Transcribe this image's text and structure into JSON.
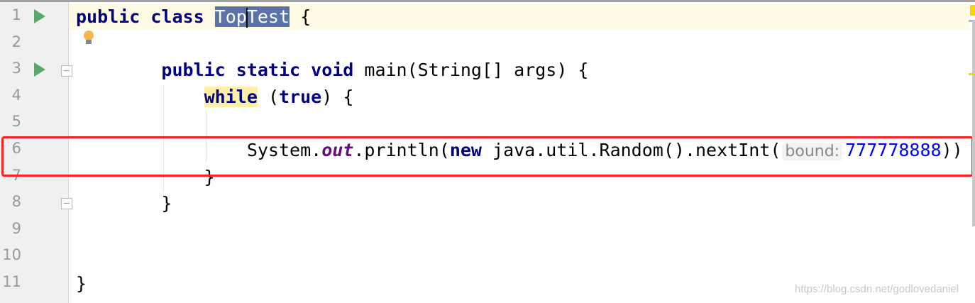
{
  "line_numbers": [
    "1",
    "2",
    "3",
    "4",
    "5",
    "6",
    "7",
    "8",
    "9",
    "10",
    "11"
  ],
  "code": {
    "l1_kw": "public class ",
    "l1_sel_a": "Top",
    "l1_sel_b": "Test",
    "l1_rest": " {",
    "l3_indent": "        ",
    "l3_kw": "public static void ",
    "l3_rest": "main(String[] args) {",
    "l4_indent": "            ",
    "l4_while": "while",
    "l4_mid": " (",
    "l4_true": "true",
    "l4_rest": ") {",
    "l6_indent": "                ",
    "l6_a": "System.",
    "l6_out": "out",
    "l6_b": ".println(",
    "l6_new": "new",
    "l6_c": " java.util.Random().nextInt(",
    "l6_hint": "bound:",
    "l6_num": "777778888",
    "l6_end": "))",
    "l7": "            }",
    "l8": "        }",
    "l11": "}"
  },
  "watermark": "https://blog.csdn.net/godlovedaniel",
  "colors": {
    "keyword": "#000080",
    "number": "#0000ff",
    "static_field": "#660e7a",
    "selection": "#5b74a8",
    "highlight_box": "#ff2020",
    "current_line": "#fffae3"
  }
}
